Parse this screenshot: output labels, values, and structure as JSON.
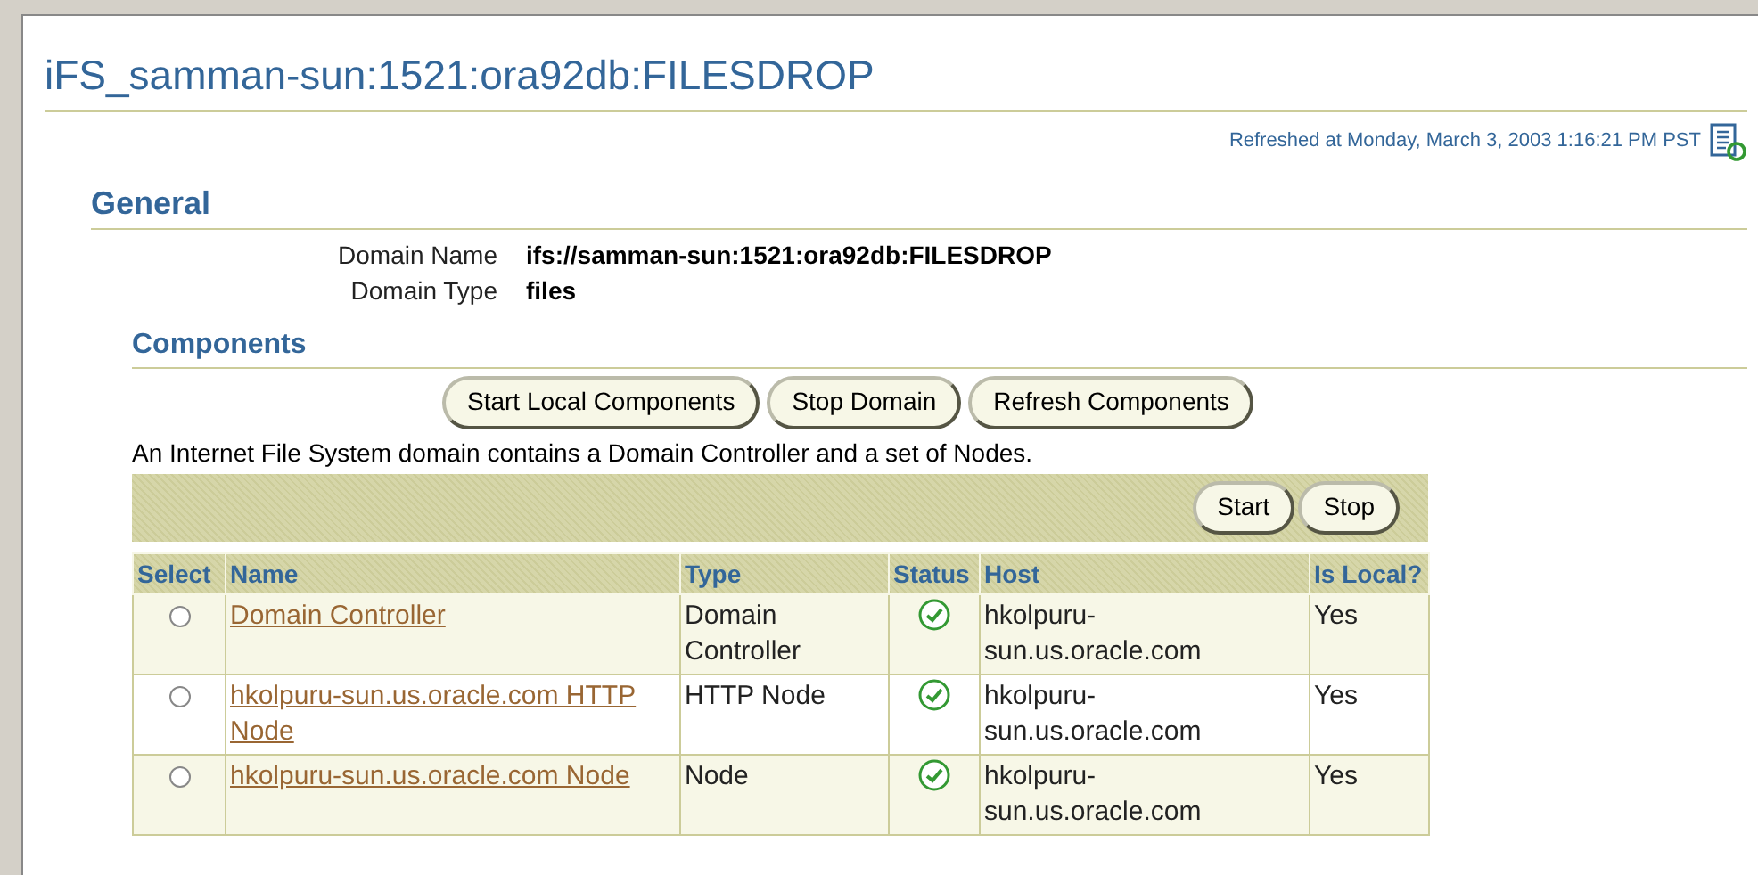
{
  "page": {
    "title": "iFS_samman-sun:1521:ora92db:FILESDROP",
    "refreshed": "Refreshed at Monday, March 3, 2003 1:16:21 PM PST"
  },
  "general": {
    "heading": "General",
    "fields": [
      {
        "label": "Domain Name",
        "value": "ifs://samman-sun:1521:ora92db:FILESDROP"
      },
      {
        "label": "Domain Type",
        "value": "files"
      }
    ]
  },
  "components": {
    "heading": "Components",
    "buttons": [
      "Start Local Components",
      "Stop Domain",
      "Refresh Components"
    ],
    "description": "An Internet File System domain contains a Domain Controller and a set of Nodes.",
    "table_buttons": [
      "Start",
      "Stop"
    ],
    "columns": [
      "Select",
      "Name",
      "Type",
      "Status",
      "Host",
      "Is Local?"
    ],
    "rows": [
      {
        "selected": false,
        "name": "Domain Controller",
        "type": "Domain Controller",
        "status_ok": true,
        "host": "hkolpuru-sun.us.oracle.com",
        "is_local": "Yes"
      },
      {
        "selected": false,
        "name": "hkolpuru-sun.us.oracle.com HTTP Node",
        "type": "HTTP Node",
        "status_ok": true,
        "host": "hkolpuru-sun.us.oracle.com",
        "is_local": "Yes"
      },
      {
        "selected": false,
        "name": "hkolpuru-sun.us.oracle.com Node",
        "type": "Node",
        "status_ok": true,
        "host": "hkolpuru-sun.us.oracle.com",
        "is_local": "Yes"
      }
    ]
  }
}
